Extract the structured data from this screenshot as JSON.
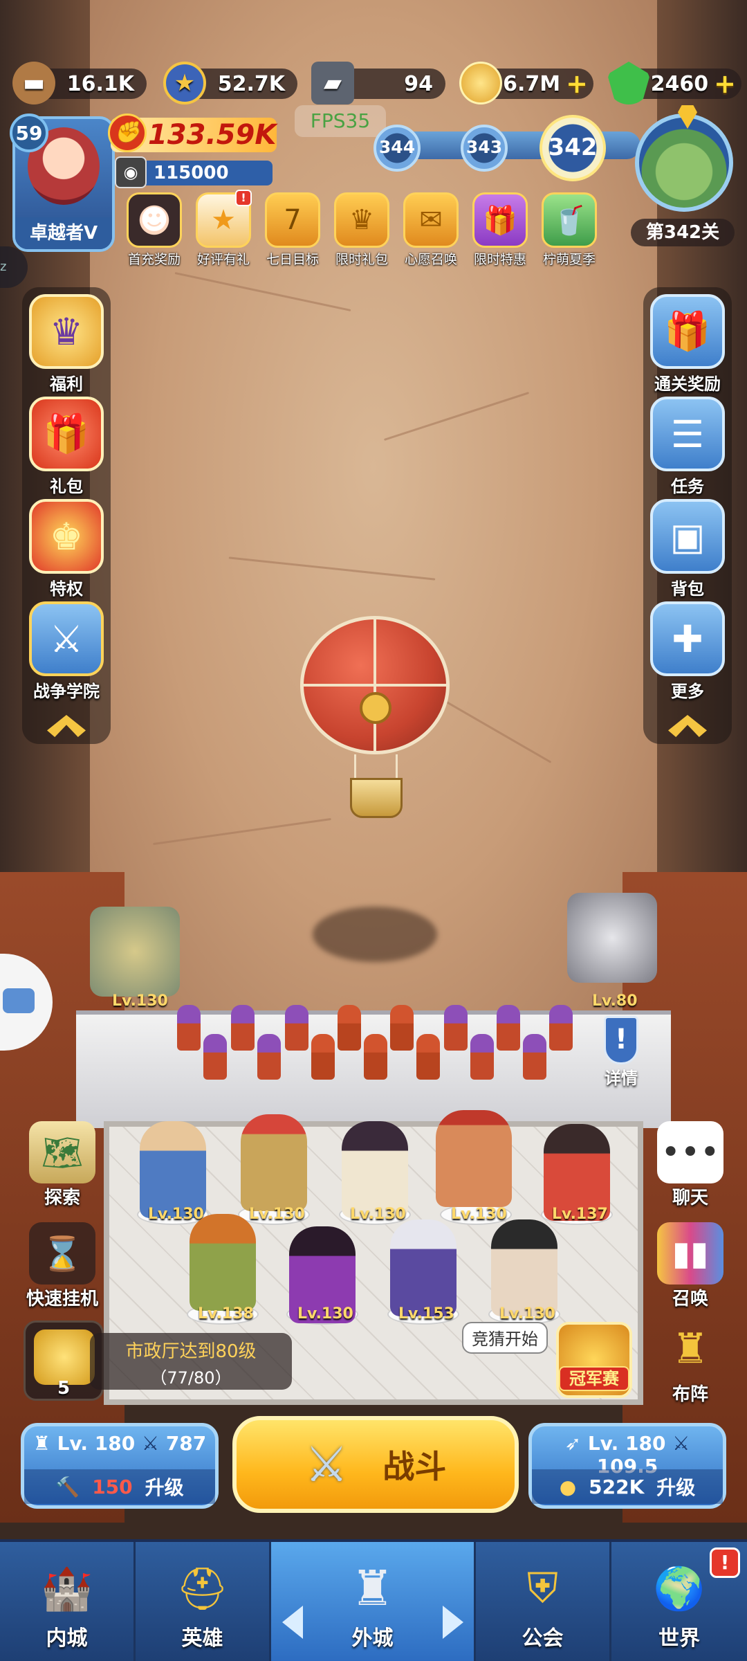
{
  "resources": [
    {
      "icon": "wood-icon",
      "value": "16.1K",
      "has_plus": false
    },
    {
      "icon": "star-coin-icon",
      "value": "52.7K",
      "has_plus": false
    },
    {
      "icon": "iron-ingot-icon",
      "value": "94",
      "has_plus": false
    },
    {
      "icon": "gold-coin-icon",
      "value": "6.7M",
      "has_plus": true
    },
    {
      "icon": "green-gem-icon",
      "value": "2460",
      "has_plus": true
    }
  ],
  "plus_symbol": "+",
  "player": {
    "level": "59",
    "name": "卓越者Ⅴ",
    "power": "133.59K",
    "hp": "115000"
  },
  "fps": "FPS35",
  "stages": {
    "previous": [
      "344",
      "343"
    ],
    "current": "342",
    "label": "第342关"
  },
  "events": [
    {
      "label": "首充奖励",
      "icon": "girl-portrait-icon",
      "badge": ""
    },
    {
      "label": "好评有礼",
      "icon": "star-card-icon",
      "badge": "!"
    },
    {
      "label": "七日目标",
      "icon": "seven-shield-icon",
      "badge": ""
    },
    {
      "label": "限时礼包",
      "icon": "crown-chest-icon",
      "badge": ""
    },
    {
      "label": "心愿召唤",
      "icon": "ticket-icon",
      "badge": ""
    },
    {
      "label": "限时特惠",
      "icon": "gift-box-icon",
      "badge": ""
    },
    {
      "label": "柠萌夏季",
      "icon": "lemon-drink-icon",
      "badge": ""
    }
  ],
  "left_menu": [
    {
      "label": "福利",
      "icon": "crown-badge-icon"
    },
    {
      "label": "礼包",
      "icon": "gift-icon"
    },
    {
      "label": "特权",
      "icon": "crown-icon"
    },
    {
      "label": "战争学院",
      "icon": "crossed-swords-shield-icon"
    }
  ],
  "right_menu": [
    {
      "label": "通关奖励",
      "icon": "gift-box-icon"
    },
    {
      "label": "任务",
      "icon": "task-list-icon"
    },
    {
      "label": "背包",
      "icon": "backpack-icon"
    },
    {
      "label": "更多",
      "icon": "plus-icon"
    }
  ],
  "towers": {
    "left_level": "Lv.130",
    "right_level": "Lv.80"
  },
  "detail_label": "详情",
  "heroes_row1": [
    "Lv.130",
    "Lv.130",
    "Lv.130",
    "Lv.130",
    "Lv.137"
  ],
  "heroes_row2": [
    "Lv.138",
    "Lv.130",
    "Lv.153",
    "Lv.130"
  ],
  "left_actions": [
    {
      "label": "探索",
      "icon": "map-sword-icon"
    },
    {
      "label": "快速挂机",
      "icon": "hourglass-icon"
    }
  ],
  "right_actions": [
    {
      "label": "聊天",
      "icon": "chat-bubble-icon"
    },
    {
      "label": "召唤",
      "icon": "summon-cards-icon"
    },
    {
      "label": "布阵",
      "icon": "chess-rook-icon"
    }
  ],
  "quest": {
    "title": "市政厅达到80级",
    "progress": "（77/80）",
    "count": "5"
  },
  "guess_label": "竞猜开始",
  "champion_label": "冠军赛",
  "left_upgrade": {
    "level": "Lv. 180",
    "attack": "787",
    "cost": "150",
    "action": "升级"
  },
  "battle_label": "战斗",
  "right_upgrade": {
    "level": "Lv. 180",
    "attack": "109.5",
    "cost": "522K",
    "action": "升级"
  },
  "nav": [
    {
      "label": "内城",
      "icon": "castle-icon",
      "active": false
    },
    {
      "label": "英雄",
      "icon": "knight-helmet-icon",
      "active": false
    },
    {
      "label": "外城",
      "icon": "fortress-icon",
      "active": true
    },
    {
      "label": "公会",
      "icon": "handshake-shield-icon",
      "active": false
    },
    {
      "label": "世界",
      "icon": "globe-icon",
      "active": false
    }
  ],
  "nav_badge": "!",
  "colors": {
    "accent_gold": "#ffb71c",
    "ui_blue": "#2f6fc3",
    "power_red": "#c2170d",
    "fps_green": "#4aa243"
  }
}
